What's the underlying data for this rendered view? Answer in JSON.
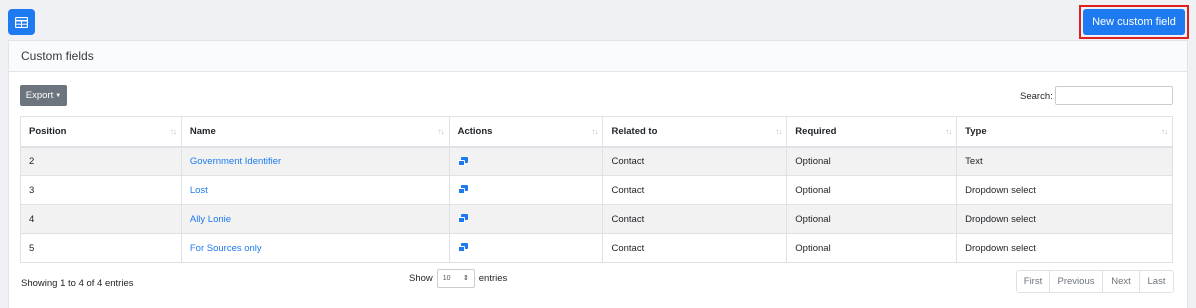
{
  "toolbar": {
    "view_icon": "table-grid-icon",
    "new_button_label": "New custom field",
    "highlight_color": "#e0201c",
    "accent_color": "#1d7af0"
  },
  "card": {
    "title": "Custom fields",
    "export_label": "Export",
    "search_label": "Search:",
    "search_value": ""
  },
  "table": {
    "columns": [
      "Position",
      "Name",
      "Actions",
      "Related to",
      "Required",
      "Type"
    ],
    "rows": [
      {
        "position": "2",
        "name": "Government Identifier",
        "related_to": "Contact",
        "required": "Optional",
        "type": "Text"
      },
      {
        "position": "3",
        "name": "Lost",
        "related_to": "Contact",
        "required": "Optional",
        "type": "Dropdown select"
      },
      {
        "position": "4",
        "name": "Ally Lonie",
        "related_to": "Contact",
        "required": "Optional",
        "type": "Dropdown select"
      },
      {
        "position": "5",
        "name": "For Sources only",
        "related_to": "Contact",
        "required": "Optional",
        "type": "Dropdown select"
      }
    ],
    "action_icon": "copy-icon"
  },
  "footer": {
    "info": "Showing 1 to 4 of 4 entries",
    "show_label": "Show",
    "length_value": "10",
    "entries_label": "entries",
    "pagination": [
      "First",
      "Previous",
      "Next",
      "Last"
    ]
  }
}
